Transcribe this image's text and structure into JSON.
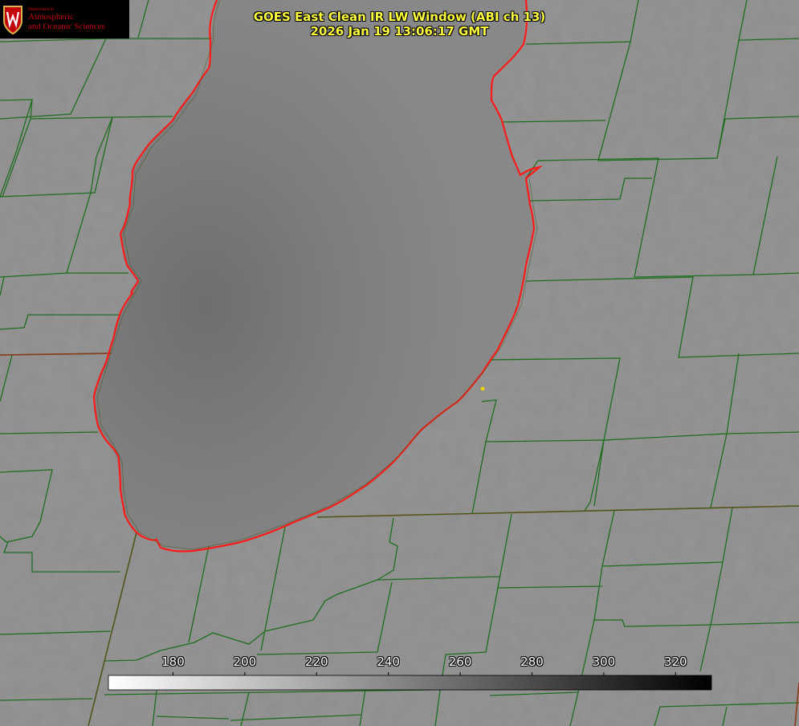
{
  "title": {
    "line1": "GOES East Clean IR LW Window (ABI ch 13)",
    "line2": "2026 Jan 19 13:06:17 GMT",
    "color": "#ffff3c"
  },
  "logo": {
    "dept": "Department of",
    "line1": "Atmospheric",
    "line2": "and Oceanic Sciences",
    "crest_letter": "W",
    "color": "#c5050c"
  },
  "colorbar": {
    "min": 162,
    "max": 330,
    "ticks": [
      "180",
      "200",
      "220",
      "240",
      "260",
      "280",
      "300",
      "320"
    ],
    "tick_values": [
      180,
      200,
      220,
      240,
      260,
      280,
      300,
      320
    ],
    "scale": "white-to-black",
    "label_color": "#ffffff"
  },
  "map": {
    "features": [
      "lake-shoreline",
      "county-boundaries",
      "state-boundaries",
      "station-marker"
    ],
    "shoreline_color": "#ff1a1a",
    "county_color": "#1e6e1e",
    "state_color": "#8a3a14",
    "marker_color": "#e6d200"
  }
}
